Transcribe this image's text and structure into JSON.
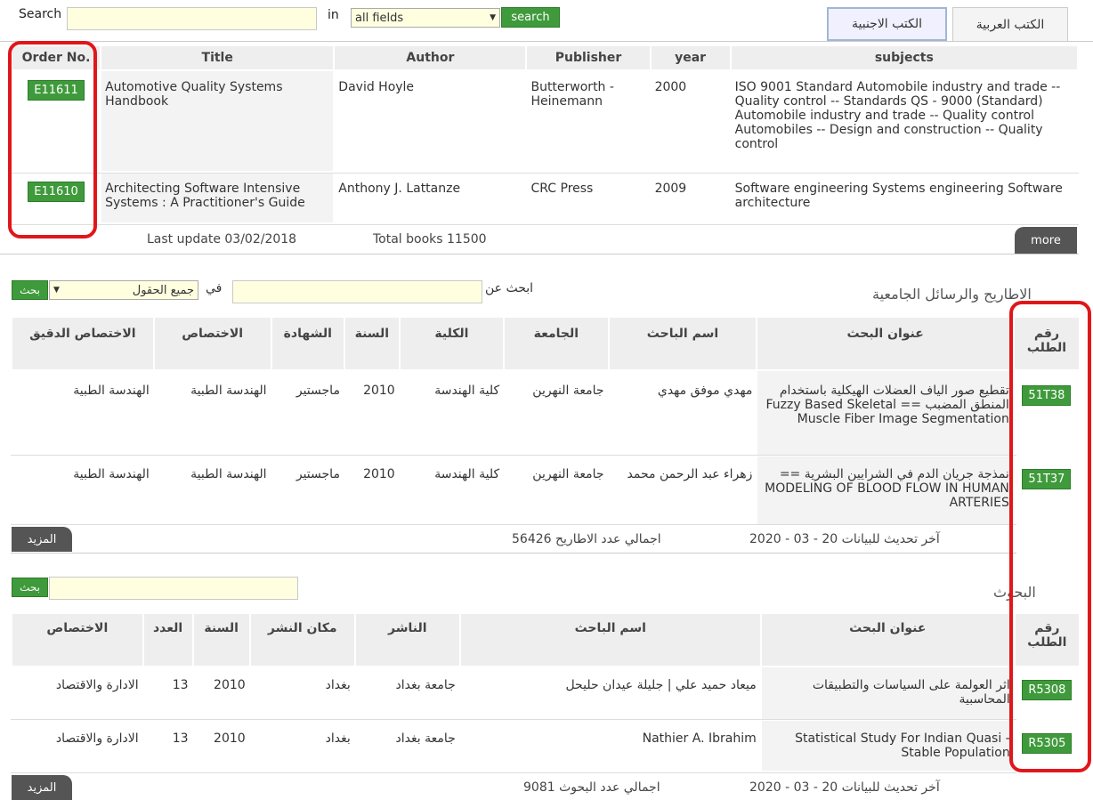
{
  "search_bar": {
    "label": "Search",
    "in_label": "in",
    "field_value": "all fields",
    "button": "search"
  },
  "tabs": [
    {
      "label": "الكتب الاجنبية",
      "active": true
    },
    {
      "label": "الكتب العربية",
      "active": false
    }
  ],
  "foreign_books": {
    "headers": [
      "Order No.",
      "Title",
      "Author",
      "Publisher",
      "year",
      "subjects"
    ],
    "rows": [
      {
        "code": "E11611",
        "title": "Automotive Quality Systems Handbook",
        "author": "David Hoyle",
        "publisher": "Butterworth - Heinemann",
        "year": "2000",
        "subjects": "ISO 9001 Standard Automobile industry and trade -- Quality control -- Standards QS - 9000 (Standard) Automobile industry and trade -- Quality control Automobiles -- Design and construction -- Quality control"
      },
      {
        "code": "E11610",
        "title": "Architecting Software Intensive Systems : A Practitioner's Guide",
        "author": "Anthony J. Lattanze",
        "publisher": "CRC Press",
        "year": "2009",
        "subjects": "Software engineering Systems engineering Software architecture"
      }
    ],
    "last_update": "Last update 03/02/2018",
    "total": "Total books 11500",
    "more": "more"
  },
  "theses": {
    "section_title": "الاطاريح والرسائل الجامعية",
    "search_label": "ابحث عن",
    "in_label": "في",
    "field_value": "جميع الحقول",
    "button": "بحث",
    "headers": [
      "رقم الطلب",
      "عنوان البحث",
      "اسم الباحث",
      "الجامعة",
      "الكلية",
      "السنة",
      "الشهادة",
      "الاختصاص",
      "الاختصاص الدقيق"
    ],
    "rows": [
      {
        "code": "51T38",
        "title": "تقطيع صور الياف العضلات الهيكلية باستخدام المنطق المضبب == Fuzzy Based Skeletal Muscle Fiber Image Segmentation",
        "researcher": "مهدي موفق مهدي",
        "university": "جامعة النهرين",
        "college": "كلية الهندسة",
        "year": "2010",
        "degree": "ماجستير",
        "specialty": "الهندسة الطبية",
        "subspecialty": "الهندسة الطبية"
      },
      {
        "code": "51T37",
        "title": "نمذجة جريان الدم في الشرايين البشرية == MODELING OF BLOOD FLOW IN HUMAN ARTERIES",
        "researcher": "زهراء عبد الرحمن محمد",
        "university": "جامعة النهرين",
        "college": "كلية الهندسة",
        "year": "2010",
        "degree": "ماجستير",
        "specialty": "الهندسة الطبية",
        "subspecialty": "الهندسة الطبية"
      }
    ],
    "last_update": "آخر تحديث للبيانات 20 - 03 - 2020",
    "total": "اجمالي عدد الاطاريح 56426",
    "more": "المزيد"
  },
  "research": {
    "section_title": "البحوث",
    "button": "بحث",
    "headers": [
      "رقم الطلب",
      "عنوان البحث",
      "اسم الباحث",
      "الناشر",
      "مكان النشر",
      "السنة",
      "العدد",
      "الاختصاص"
    ],
    "rows": [
      {
        "code": "R5308",
        "title": "اثر العولمة على السياسات والتطبيقات المحاسبية",
        "researcher": "ميعاد حميد علي | جليلة عيدان حليحل",
        "publisher": "جامعة بغداد",
        "place": "بغداد",
        "year": "2010",
        "issue": "13",
        "specialty": "الادارة والاقتصاد"
      },
      {
        "code": "R5305",
        "title": "Statistical Study For Indian Quasi - Stable Population",
        "researcher": "Nathier A. Ibrahim",
        "publisher": "جامعة بغداد",
        "place": "بغداد",
        "year": "2010",
        "issue": "13",
        "specialty": "الادارة والاقتصاد"
      }
    ],
    "last_update": "آخر تحديث للبيانات 20 - 03 - 2020",
    "total": "اجمالي عدد البحوث 9081",
    "more": "المزيد"
  },
  "colors": {
    "accent_green": "#3f9a3b",
    "highlight_red": "#e0171a",
    "input_yellow": "#ffffe0",
    "dark_button": "#555555"
  },
  "icons": {
    "dropdown": "triangle-down"
  }
}
